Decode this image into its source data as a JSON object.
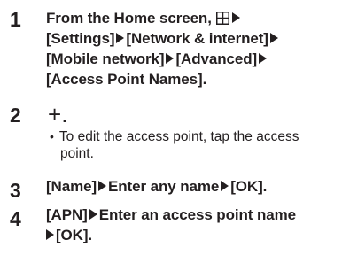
{
  "steps": [
    {
      "number": "1",
      "lines": [
        "From the Home screen,",
        "[Settings]",
        "[Network & internet]",
        "[Mobile network]",
        "[Advanced]",
        "[Access Point Names]."
      ]
    },
    {
      "number": "2",
      "symbol": "+",
      "symbol_suffix": ".",
      "note_line1": "To edit the access point, tap the access",
      "note_line2": "point."
    },
    {
      "number": "3",
      "parts": [
        "[Name]",
        "Enter any name",
        "[OK]."
      ]
    },
    {
      "number": "4",
      "parts": [
        "[APN]",
        "Enter an access point name",
        "[OK]."
      ]
    }
  ],
  "icons": {
    "apps": "apps-grid-icon",
    "arrow": "right-triangle-arrow-icon"
  }
}
